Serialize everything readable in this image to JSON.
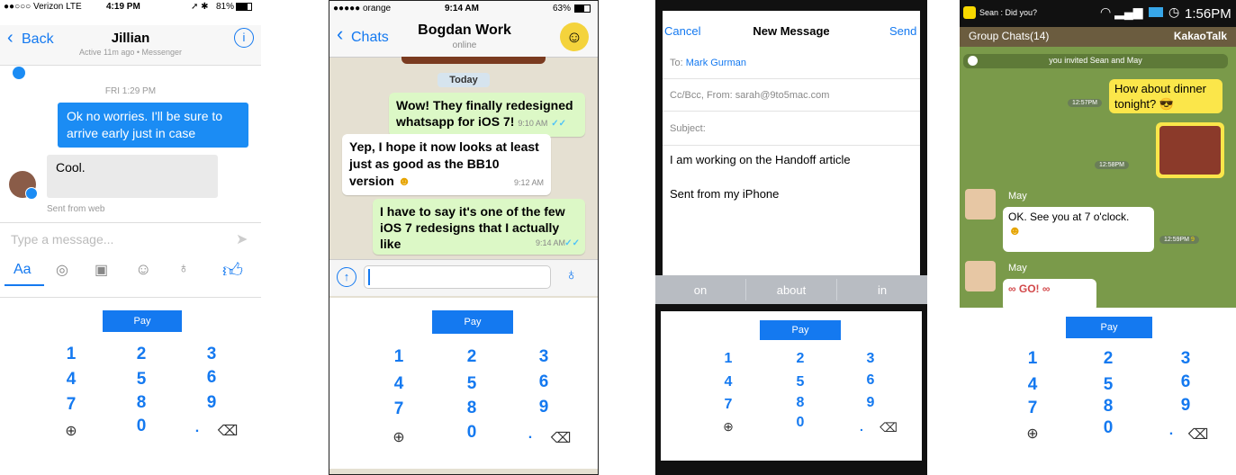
{
  "keypad": {
    "pay_label": "Pay",
    "keys": [
      "1",
      "2",
      "3",
      "4",
      "5",
      "6",
      "7",
      "8",
      "9",
      "0"
    ],
    "globe_icon": "globe-icon",
    "dot": ".",
    "backspace_icon": "backspace-icon",
    "accent": "#1479f0"
  },
  "messenger": {
    "status": {
      "carrier": "●●○○○ Verizon  LTE",
      "time": "4:19 PM",
      "battery": "81%"
    },
    "back_label": "Back",
    "contact_name": "Jillian",
    "contact_sub": "Active 11m ago • Messenger",
    "date_label": "FRI 1:29 PM",
    "outgoing": "Ok no worries. I'll be sure to arrive early just in case",
    "incoming": "Cool.",
    "sent_from": "Sent from web",
    "input_placeholder": "Type a message...",
    "toolbar_aa": "Aa"
  },
  "whatsapp": {
    "status": {
      "carrier": "●●●●● orange",
      "time": "9:14 AM",
      "battery": "63%"
    },
    "back_label": "Chats",
    "contact_name": "Bogdan Work",
    "contact_sub": "online",
    "date_label": "Today",
    "messages": [
      {
        "text": "Wow! They finally redesigned whatsapp for iOS 7!",
        "time": "9:10 AM"
      },
      {
        "text": "Yep, I hope it now looks at least just as good as the BB10 version",
        "time": "9:12 AM"
      },
      {
        "text": "I have to say it's one of the few iOS 7 redesigns that I actually like",
        "time": "9:14 AM"
      }
    ]
  },
  "mail": {
    "cancel_label": "Cancel",
    "title": "New Message",
    "send_label": "Send",
    "to_label": "To:",
    "to_value": "Mark Gurman",
    "cc_label": "Cc/Bcc, From: sarah@9to5mac.com",
    "subject_label": "Subject:",
    "body_line1": "I am working on the Handoff article",
    "body_line2": "Sent from my iPhone",
    "suggestions": [
      "on",
      "about",
      "in"
    ]
  },
  "kakao": {
    "status": {
      "notification": "Sean : Did you?",
      "time": "1:56PM"
    },
    "group_label": "Group Chats(14)",
    "app_label": "KakaoTalk",
    "invite_text": "you invited Sean and May",
    "msg1": "How about dinner tonight?",
    "msg1_time": "12:57PM",
    "photo_time": "12:58PM",
    "sender": "May",
    "msg2": "OK. See you at 7 o'clock.",
    "msg2_time": "12:59PM",
    "msg2_unread": "9",
    "sender2": "May"
  }
}
